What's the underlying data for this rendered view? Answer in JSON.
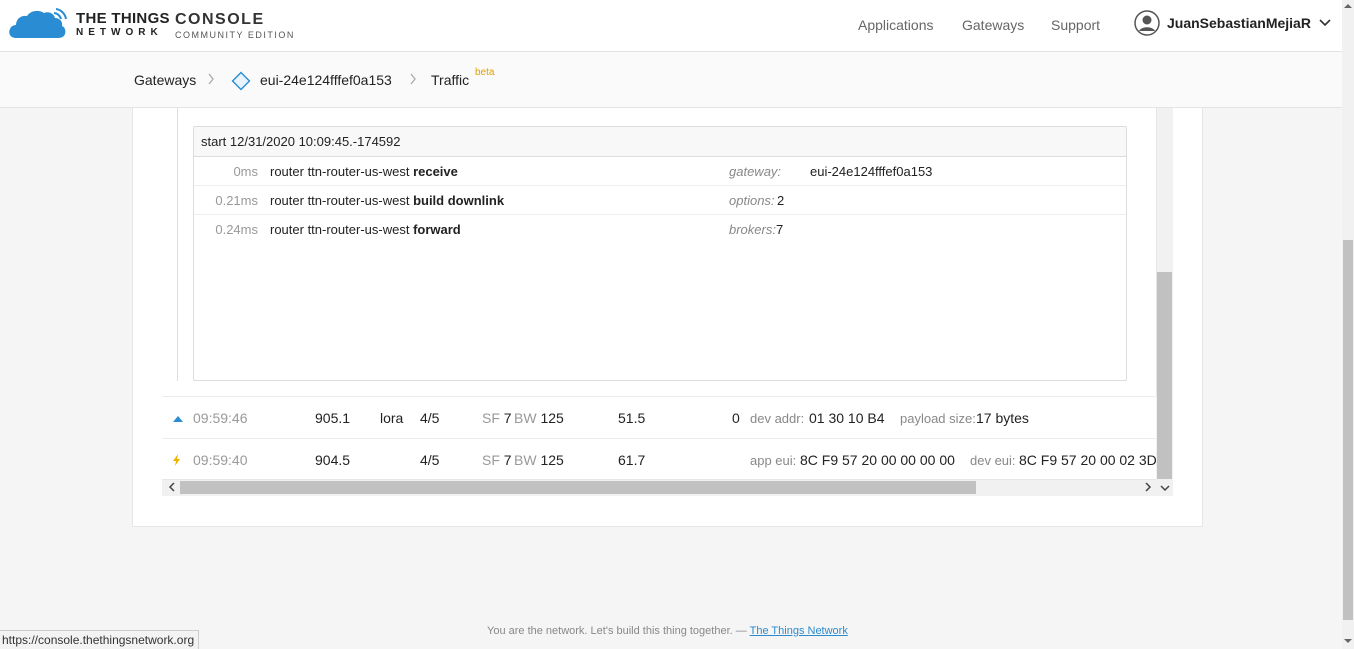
{
  "header": {
    "logo_line1": "THE THINGS",
    "logo_line2": "NETWORK",
    "console_title": "CONSOLE",
    "console_subtitle": "COMMUNITY EDITION",
    "nav": [
      "Applications",
      "Gateways",
      "Support"
    ],
    "username": "JuanSebastianMejiaR"
  },
  "breadcrumb": {
    "root": "Gateways",
    "gateway": "eui-24e124fffef0a153",
    "current": "Traffic",
    "badge": "beta"
  },
  "trace": {
    "start": "start 12/31/2020 10:09:45.-174592",
    "rows": [
      {
        "time": "0ms",
        "prefix": "router ttn-router-us-west",
        "action": "receive",
        "key": "gateway:",
        "value": "eui-24e124fffef0a153"
      },
      {
        "time": "0.21ms",
        "prefix": "router ttn-router-us-west",
        "action": "build downlink",
        "key": "options:",
        "value": "2"
      },
      {
        "time": "0.24ms",
        "prefix": "router ttn-router-us-west",
        "action": "forward",
        "key": "brokers:",
        "value": "7"
      }
    ]
  },
  "traffic": {
    "uplink": {
      "time": "09:59:46",
      "frequency": "905.1",
      "modulation": "lora",
      "coding_rate": "4/5",
      "sf_label": "SF",
      "sf": "7",
      "bw_label": "BW",
      "bw": "125",
      "airtime": "51.5",
      "counter": "0",
      "dev_addr_label": "dev addr:",
      "dev_addr": "01 30 10 B4",
      "payload_label": "payload size:",
      "payload": "17 bytes"
    },
    "join": {
      "time": "09:59:40",
      "frequency": "904.5",
      "coding_rate": "4/5",
      "sf_label": "SF",
      "sf": "7",
      "bw_label": "BW",
      "bw": "125",
      "airtime": "61.7",
      "app_eui_label": "app eui:",
      "app_eui": "8C F9 57 20 00 00 00 00",
      "dev_eui_label": "dev eui:",
      "dev_eui": "8C F9 57 20 00 02 3D"
    }
  },
  "footer": {
    "text": "You are the network. Let's build this thing together. — ",
    "link": "The Things Network"
  },
  "status_url": "https://console.thethingsnetwork.org",
  "colors": {
    "brand_blue": "#2a8dd4",
    "beta": "#e0a100",
    "uplink_arrow": "#2a8dd4",
    "join_bolt": "#f0b400"
  }
}
